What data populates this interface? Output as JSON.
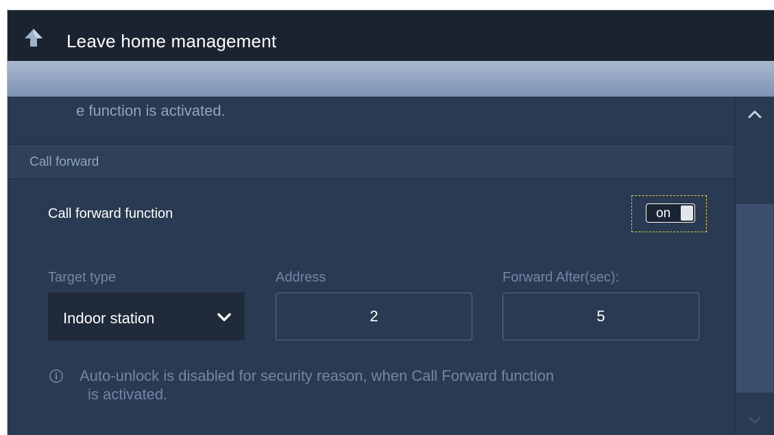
{
  "header": {
    "title": "Leave home management",
    "back_icon": "arrow-up-icon"
  },
  "content": {
    "prev_text_fragment": "e function is activated.",
    "section": {
      "title": "Call forward"
    },
    "call_forward": {
      "label": "Call forward function",
      "toggle_text": "on",
      "toggle_state": "on"
    },
    "fields": {
      "target_type": {
        "label": "Target type",
        "value": "Indoor station"
      },
      "address": {
        "label": "Address",
        "value": "2"
      },
      "forward_after": {
        "label": "Forward After(sec):",
        "value": "5"
      }
    },
    "info_line1": "Auto-unlock is disabled for security reason, when Call Forward function",
    "info_line2": "is activated."
  },
  "scrollbar": {
    "up_icon": "chevron-up-icon",
    "down_icon": "chevron-down-icon"
  },
  "colors": {
    "background": "#2a3a52",
    "titlebar": "#1c2330",
    "banner": "#9aaac4",
    "label_muted": "#7287a6",
    "focus_outline": "#e6d84a"
  }
}
